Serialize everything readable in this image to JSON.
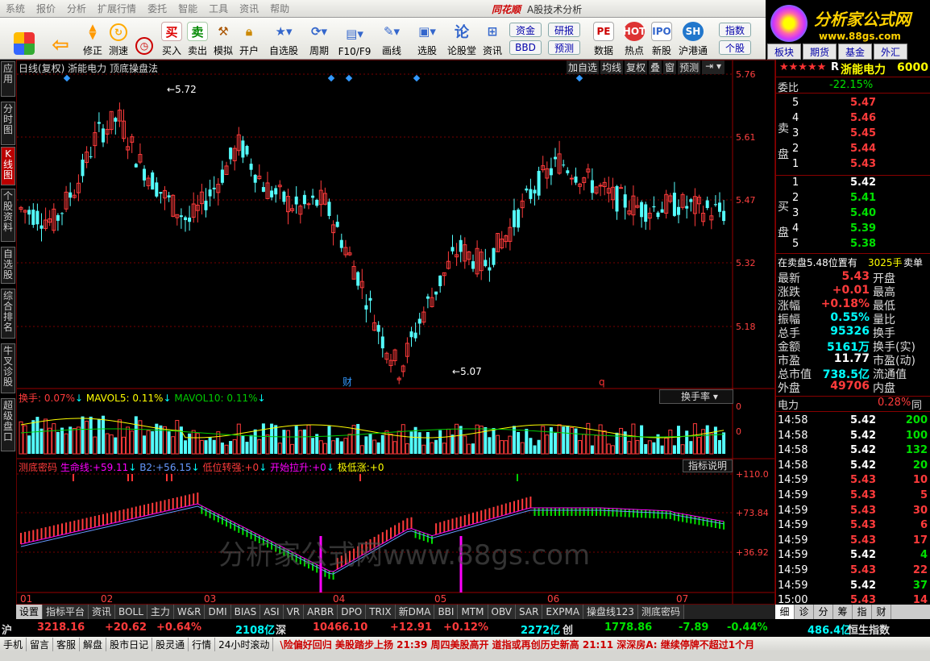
{
  "menu": {
    "items": [
      "系统",
      "报价",
      "分析",
      "扩展行情",
      "委托",
      "智能",
      "工具",
      "资讯",
      "帮助"
    ],
    "brand": "同花顺",
    "title": "A股技术分析"
  },
  "toolbar": {
    "buttons": [
      {
        "label": "买入",
        "icon": "buy-icon"
      },
      {
        "label": "卖出",
        "icon": "sell-icon"
      },
      {
        "label": "模拟",
        "icon": "hammer-icon"
      },
      {
        "label": "开户",
        "icon": "lock-icon"
      },
      {
        "label": "修正",
        "icon": "up-arrow-icon"
      },
      {
        "label": "测速",
        "icon": "clock-icon"
      },
      {
        "label": "自选股",
        "icon": "star-icon"
      },
      {
        "label": "周期",
        "icon": "cycle-icon"
      },
      {
        "label": "F10/F9",
        "icon": "f10-icon"
      },
      {
        "label": "画线",
        "icon": "pencil-icon"
      },
      {
        "label": "选股",
        "icon": "screen-icon"
      },
      {
        "label": "论股堂",
        "icon": "discuss-icon"
      },
      {
        "label": "资讯",
        "icon": "news-icon"
      },
      {
        "label": "数据",
        "icon": "pe-icon"
      },
      {
        "label": "热点",
        "icon": "hot-icon"
      },
      {
        "label": "新股",
        "icon": "ipo-icon"
      },
      {
        "label": "沪港通",
        "icon": "hk-icon"
      }
    ],
    "small": [
      "资金",
      "研报",
      "BBD",
      "预测",
      "指数",
      "个股"
    ],
    "logo_tabs": [
      "板块",
      "期货",
      "基金",
      "外汇"
    ]
  },
  "logo": {
    "title": "分析家公式网",
    "url": "www.88gs.com"
  },
  "sidetabs": [
    "应用",
    "分时图",
    "K线图",
    "个股资料",
    "自选股",
    "综合排名",
    "牛叉诊股",
    "超级盘口"
  ],
  "kchart": {
    "header": "日线(复权)  浙能电力  顶底操盘法",
    "buttons": [
      "加自选",
      "均线",
      "复权",
      "叠",
      "窗",
      "预测"
    ],
    "price_labels": [
      "5.76",
      "5.61",
      "5.47",
      "5.32",
      "5.18"
    ],
    "high_note": "5.72",
    "low_note": "5.07",
    "markers": [
      "财",
      "q"
    ]
  },
  "volchart": {
    "header": "换手:",
    "val1": "0.07%",
    "mavol5_label": "MAVOL5:",
    "mavol5": "0.11%",
    "mavol10_label": "MAVOL10:",
    "mavol10": "0.11%",
    "dropdown": "换手率",
    "ticks": [
      "0",
      "0"
    ]
  },
  "indchart": {
    "name": "测底密码",
    "l1": "生命线:",
    "v1": "+59.11",
    "l2": "B2:",
    "v2": "+56.15",
    "l3": "低位转强:",
    "v3": "+0",
    "l4": "开始拉升:",
    "v4": "+0",
    "l5": "极低涨:",
    "v5": "+0",
    "button": "指标说明",
    "ticks": [
      "+110.0",
      "+73.84",
      "+36.92"
    ],
    "months": [
      "01",
      "02",
      "03",
      "04",
      "05",
      "06",
      "07"
    ],
    "watermark": "分析家公式网www.88gs.com"
  },
  "bottom_tabs": [
    "设置",
    "指标平台",
    "资讯",
    "BOLL",
    "主力",
    "W&R",
    "DMI",
    "BIAS",
    "ASI",
    "VR",
    "ARBR",
    "DPO",
    "TRIX",
    "新DMA",
    "BBI",
    "MTM",
    "OBV",
    "SAR",
    "EXPMA",
    "操盘线123",
    "测底密码"
  ],
  "right_tabs": [
    "细",
    "诊",
    "分",
    "筹",
    "指",
    "财"
  ],
  "quote": {
    "stars": "★★★★★",
    "flag": "R",
    "name": "浙能电力",
    "code": "6000",
    "webi_label": "委比",
    "webi": "-22.15%",
    "sell_label": "卖盘",
    "buy_label": "买盘",
    "sell": [
      [
        "5",
        "5.47"
      ],
      [
        "4",
        "5.46"
      ],
      [
        "3",
        "5.45"
      ],
      [
        "2",
        "5.44"
      ],
      [
        "1",
        "5.43"
      ]
    ],
    "buy": [
      [
        "1",
        "5.42"
      ],
      [
        "2",
        "5.41"
      ],
      [
        "3",
        "5.40"
      ],
      [
        "4",
        "5.39"
      ],
      [
        "5",
        "5.38"
      ]
    ],
    "note": "在卖盘5.48位置有",
    "note_vol": "3025手",
    "note_end": "卖单",
    "stats": [
      [
        "最新",
        "5.43",
        "开盘"
      ],
      [
        "涨跌",
        "+0.01",
        "最高"
      ],
      [
        "涨幅",
        "+0.18%",
        "最低"
      ],
      [
        "振幅",
        "0.55%",
        "量比"
      ],
      [
        "总手",
        "95326",
        "换手"
      ],
      [
        "金额",
        "5161万",
        "换手(实)"
      ],
      [
        "市盈",
        "11.77",
        "市盈(动)"
      ],
      [
        "总市值",
        "738.5亿",
        "流通值"
      ],
      [
        "外盘",
        "49706",
        "内盘"
      ]
    ],
    "power_label": "电力",
    "power": "0.28%",
    "power_end": "同",
    "ticks": [
      [
        "14:58",
        "5.42",
        "200"
      ],
      [
        "14:58",
        "5.42",
        "100"
      ],
      [
        "14:58",
        "5.42",
        "132"
      ],
      [
        "14:58",
        "5.42",
        "20"
      ],
      [
        "14:59",
        "5.43",
        "10"
      ],
      [
        "14:59",
        "5.43",
        "5"
      ],
      [
        "14:59",
        "5.43",
        "30"
      ],
      [
        "14:59",
        "5.43",
        "6"
      ],
      [
        "14:59",
        "5.43",
        "17"
      ],
      [
        "14:59",
        "5.42",
        "4"
      ],
      [
        "14:59",
        "5.43",
        "22"
      ],
      [
        "14:59",
        "5.42",
        "37"
      ],
      [
        "15:00",
        "5.43",
        "14"
      ]
    ]
  },
  "indexbar": {
    "sh_label": "沪",
    "sh": "3218.16",
    "sh_chg": "+20.62",
    "sh_pct": "+0.64%",
    "sh_amt": "2108亿",
    "sz_label": "深",
    "sz": "10466.10",
    "sz_chg": "+12.91",
    "sz_pct": "+0.12%",
    "sz_amt": "2272亿",
    "cy_label": "创",
    "cy": "1778.86",
    "cy_chg": "-7.89",
    "cy_pct": "-0.44%",
    "cy_amt": "486.4亿",
    "hs_label": "恒生指数"
  },
  "statusbar": {
    "items": [
      "手机",
      "留言",
      "客服",
      "解盘",
      "股市日记",
      "股灵通",
      "行情",
      "24小时滚动"
    ],
    "ticker": "\\险偏好回归 美股踏步上扬    21:39 周四美股高开 道指或再创历史新高    21:11 深深房A: 继续停牌不超过1个月"
  }
}
